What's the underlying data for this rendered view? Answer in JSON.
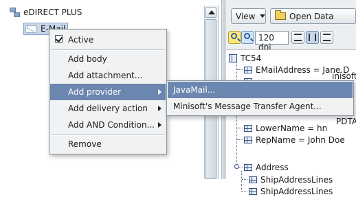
{
  "tree": {
    "root_label": "eDIRECT PLUS",
    "email_label": "E-Mail"
  },
  "toolbar": {
    "view_label": "View",
    "open_data_label": "Open Data",
    "dpi_value": "120 dpi"
  },
  "document": {
    "root": "TC54",
    "rows": [
      "EMailAddress = Jane.D",
      "PDTA",
      "LowerName = hn",
      "RepName = John Doe",
      "Address",
      "ShipAddressLines",
      "ShipAddressLines"
    ],
    "partial_text": "inisoft"
  },
  "context_menu": {
    "active_label": "Active",
    "active_checked": true,
    "items": [
      "Add body",
      "Add attachment...",
      "Add provider",
      "Add delivery action",
      "Add AND Condition...",
      "Remove"
    ]
  },
  "submenu": {
    "items": [
      "JavaMail...",
      "Minisoft's Message Transfer Agent..."
    ]
  }
}
